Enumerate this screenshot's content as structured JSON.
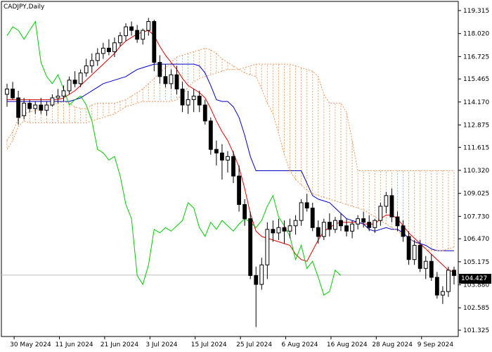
{
  "chart_data": {
    "type": "candlestick",
    "title": "CADJPY,Daily",
    "symbol": "CADJPY",
    "timeframe": "Daily",
    "current_price": "104.427",
    "ylim": [
      101.325,
      119.315
    ],
    "y_ticks": [
      "119.315",
      "118.020",
      "116.725",
      "115.465",
      "114.170",
      "112.875",
      "111.615",
      "110.320",
      "109.025",
      "107.730",
      "106.470",
      "105.175",
      "103.880",
      "102.585",
      "101.325"
    ],
    "x_ticks": [
      {
        "label": "30 May 2024",
        "index": 2
      },
      {
        "label": "11 Jun 2024",
        "index": 10
      },
      {
        "label": "21 Jun 2024",
        "index": 18
      },
      {
        "label": "3 Jul 2024",
        "index": 26
      },
      {
        "label": "15 Jul 2024",
        "index": 34
      },
      {
        "label": "25 Jul 2024",
        "index": 42
      },
      {
        "label": "6 Aug 2024",
        "index": 50
      },
      {
        "label": "16 Aug 2024",
        "index": 58
      },
      {
        "label": "28 Aug 2024",
        "index": 66
      },
      {
        "label": "9 Sep 2024",
        "index": 74
      }
    ],
    "candles": [
      [
        114.6,
        115.2,
        113.9,
        114.9
      ],
      [
        114.9,
        115.3,
        114.3,
        114.4
      ],
      [
        114.4,
        114.8,
        112.9,
        113.3
      ],
      [
        113.4,
        114.4,
        113.2,
        114.1
      ],
      [
        114.1,
        114.3,
        113.6,
        113.8
      ],
      [
        113.8,
        114.2,
        113.5,
        114.0
      ],
      [
        114.0,
        114.4,
        113.5,
        113.7
      ],
      [
        113.7,
        114.2,
        113.4,
        114.0
      ],
      [
        114.0,
        114.6,
        113.9,
        114.4
      ],
      [
        114.4,
        114.9,
        114.1,
        114.5
      ],
      [
        114.5,
        115.1,
        114.2,
        114.8
      ],
      [
        114.8,
        115.6,
        114.6,
        115.4
      ],
      [
        115.4,
        115.9,
        115.0,
        115.2
      ],
      [
        115.2,
        116.0,
        115.0,
        115.8
      ],
      [
        115.8,
        116.6,
        115.6,
        116.2
      ],
      [
        116.2,
        116.9,
        115.8,
        116.5
      ],
      [
        116.5,
        117.2,
        116.2,
        116.9
      ],
      [
        116.9,
        117.5,
        116.6,
        117.2
      ],
      [
        117.2,
        117.7,
        116.8,
        117.0
      ],
      [
        117.0,
        117.8,
        116.7,
        117.5
      ],
      [
        117.5,
        118.1,
        117.3,
        117.9
      ],
      [
        117.9,
        118.6,
        117.6,
        118.4
      ],
      [
        118.4,
        118.7,
        117.9,
        118.2
      ],
      [
        118.2,
        118.5,
        117.5,
        117.7
      ],
      [
        117.7,
        118.3,
        117.4,
        118.2
      ],
      [
        118.2,
        118.9,
        117.9,
        118.7
      ],
      [
        118.7,
        118.8,
        115.9,
        116.4
      ],
      [
        116.4,
        116.8,
        115.2,
        115.6
      ],
      [
        115.6,
        116.3,
        115.0,
        115.2
      ],
      [
        115.2,
        116.0,
        114.9,
        115.7
      ],
      [
        115.7,
        116.2,
        114.6,
        114.9
      ],
      [
        114.9,
        115.3,
        113.6,
        114.0
      ],
      [
        114.0,
        114.8,
        113.5,
        114.3
      ],
      [
        114.3,
        114.9,
        113.6,
        114.5
      ],
      [
        114.5,
        114.8,
        113.6,
        114.0
      ],
      [
        114.0,
        114.3,
        112.9,
        113.1
      ],
      [
        113.1,
        113.3,
        111.2,
        111.5
      ],
      [
        111.5,
        112.0,
        110.6,
        111.3
      ],
      [
        111.3,
        111.8,
        109.8,
        110.9
      ],
      [
        110.9,
        111.4,
        110.2,
        111.1
      ],
      [
        111.1,
        111.4,
        109.6,
        110.0
      ],
      [
        110.0,
        110.6,
        108.0,
        108.4
      ],
      [
        108.4,
        108.7,
        107.2,
        107.6
      ],
      [
        107.6,
        108.0,
        104.2,
        104.4
      ],
      [
        104.4,
        104.9,
        101.5,
        103.9
      ],
      [
        103.9,
        105.4,
        103.6,
        105.0
      ],
      [
        105.0,
        107.4,
        104.2,
        107.0
      ],
      [
        107.0,
        107.5,
        106.3,
        106.8
      ],
      [
        106.8,
        107.6,
        106.4,
        107.1
      ],
      [
        107.1,
        107.5,
        106.2,
        106.9
      ],
      [
        106.9,
        107.6,
        106.5,
        107.2
      ],
      [
        107.2,
        107.8,
        106.7,
        107.5
      ],
      [
        107.5,
        108.7,
        107.2,
        108.5
      ],
      [
        108.5,
        109.0,
        108.0,
        108.2
      ],
      [
        108.2,
        108.5,
        106.9,
        107.1
      ],
      [
        107.1,
        107.5,
        106.2,
        106.6
      ],
      [
        106.6,
        107.6,
        106.4,
        107.4
      ],
      [
        107.4,
        107.9,
        106.6,
        107.0
      ],
      [
        107.0,
        107.7,
        106.8,
        107.5
      ],
      [
        107.5,
        107.9,
        106.9,
        107.2
      ],
      [
        107.2,
        107.6,
        106.6,
        106.9
      ],
      [
        106.9,
        107.5,
        106.5,
        107.3
      ],
      [
        107.3,
        107.8,
        107.0,
        107.6
      ],
      [
        107.6,
        108.0,
        107.1,
        107.4
      ],
      [
        107.4,
        107.8,
        106.9,
        107.1
      ],
      [
        107.1,
        107.6,
        106.8,
        107.5
      ],
      [
        107.5,
        108.5,
        107.2,
        108.3
      ],
      [
        108.3,
        109.1,
        107.9,
        108.9
      ],
      [
        108.9,
        109.3,
        107.4,
        107.7
      ],
      [
        107.7,
        108.0,
        106.9,
        107.2
      ],
      [
        107.2,
        107.5,
        106.3,
        106.6
      ],
      [
        106.6,
        106.9,
        105.0,
        105.3
      ],
      [
        105.3,
        106.4,
        105.0,
        106.1
      ],
      [
        106.1,
        106.4,
        104.6,
        104.8
      ],
      [
        104.8,
        105.5,
        104.2,
        105.2
      ],
      [
        105.2,
        105.6,
        104.1,
        104.3
      ],
      [
        104.3,
        104.6,
        103.1,
        103.3
      ],
      [
        103.3,
        103.8,
        102.8,
        103.5
      ],
      [
        103.5,
        104.9,
        103.2,
        104.7
      ],
      [
        104.7,
        104.9,
        103.9,
        104.4
      ]
    ],
    "indicators": [
      {
        "name": "tenkan",
        "color": "#dd0000",
        "values": [
          114.3,
          114.3,
          114.3,
          114.3,
          114.3,
          114.3,
          114.3,
          114.3,
          114.3,
          114.3,
          114.4,
          114.6,
          114.8,
          115.1,
          115.4,
          115.7,
          116.0,
          116.3,
          116.6,
          116.9,
          117.3,
          117.6,
          117.8,
          118.0,
          118.1,
          118.2,
          117.9,
          117.3,
          116.8,
          116.4,
          116.0,
          115.5,
          115.1,
          114.9,
          114.7,
          114.4,
          113.8,
          113.1,
          112.5,
          112.0,
          111.3,
          110.5,
          109.3,
          107.9,
          106.9,
          106.6,
          106.5,
          106.4,
          106.3,
          106.2,
          106.1,
          105.6,
          105.3,
          105.2,
          105.8,
          106.4,
          106.9,
          107.1,
          107.3,
          107.4,
          107.4,
          107.4,
          107.4,
          107.3,
          107.3,
          107.3,
          107.6,
          107.8,
          107.8,
          107.6,
          107.2,
          106.8,
          106.5,
          106.2,
          105.9,
          105.6,
          105.3,
          105.0,
          104.7,
          104.6
        ]
      },
      {
        "name": "kijun",
        "color": "#0000cc",
        "values": [
          114.2,
          114.2,
          114.2,
          114.2,
          114.2,
          114.2,
          114.2,
          114.2,
          114.2,
          114.2,
          114.2,
          114.2,
          114.3,
          114.4,
          114.6,
          114.8,
          115.0,
          115.2,
          115.3,
          115.4,
          115.5,
          115.6,
          115.8,
          116.0,
          116.1,
          116.2,
          116.3,
          116.3,
          116.3,
          116.3,
          116.3,
          116.3,
          116.3,
          116.3,
          116.2,
          115.8,
          115.1,
          114.3,
          114.2,
          114.2,
          113.9,
          113.3,
          112.3,
          111.1,
          110.3,
          110.3,
          110.3,
          110.3,
          110.3,
          110.3,
          110.3,
          110.3,
          110.3,
          109.6,
          108.9,
          108.7,
          108.6,
          108.5,
          108.2,
          107.9,
          107.6,
          107.5,
          107.4,
          107.3,
          107.0,
          106.9,
          107.0,
          107.1,
          107.0,
          107.0,
          106.8,
          106.5,
          106.3,
          106.2,
          106.1,
          105.9,
          105.8,
          105.8,
          105.8,
          105.8
        ]
      },
      {
        "name": "chikou",
        "color": "#00cc00",
        "values": [
          117.9,
          118.4,
          118.2,
          117.7,
          118.2,
          118.7,
          116.4,
          115.6,
          115.2,
          115.7,
          114.9,
          114.0,
          114.3,
          114.5,
          114.0,
          113.1,
          111.5,
          111.3,
          110.9,
          111.1,
          110.0,
          108.4,
          107.6,
          104.4,
          103.9,
          105.0,
          107.0,
          106.8,
          107.1,
          106.9,
          107.2,
          107.5,
          108.5,
          108.2,
          107.1,
          106.6,
          107.4,
          107.0,
          107.5,
          107.2,
          106.9,
          107.3,
          107.6,
          107.4,
          107.1,
          107.5,
          108.3,
          108.9,
          107.7,
          107.2,
          106.6,
          105.3,
          106.1,
          104.8,
          105.2,
          104.3,
          103.3,
          103.5,
          104.7,
          104.4
        ]
      },
      {
        "name": "senkou_a",
        "color": "#e8985e",
        "dashed": true,
        "values": [
          112.0,
          112.5,
          113.2,
          113.5,
          113.6,
          113.7,
          113.8,
          113.9,
          114.0,
          114.1,
          114.2,
          114.1,
          113.9,
          113.8,
          113.8,
          114.0,
          114.1,
          114.1,
          114.1,
          114.1,
          114.2,
          114.3,
          114.5,
          114.7,
          114.9,
          115.2,
          115.5,
          115.8,
          116.1,
          116.4,
          116.7,
          116.8,
          116.9,
          117.0,
          117.1,
          117.2,
          117.1,
          116.9,
          116.6,
          116.4,
          116.2,
          116.0,
          115.8,
          115.7,
          115.6,
          114.9,
          114.1,
          113.5,
          112.4,
          111.2,
          110.3,
          109.8,
          109.5,
          109.2,
          109.0,
          108.9,
          108.8,
          108.7,
          108.6,
          108.5,
          108.4,
          108.3,
          108.2,
          108.1,
          107.9,
          107.7,
          107.5,
          107.3,
          107.1,
          106.9,
          106.7,
          106.5,
          106.3,
          106.1,
          105.9,
          105.8,
          105.8,
          105.8,
          105.9,
          106.0
        ]
      },
      {
        "name": "senkou_b",
        "color": "#e8985e",
        "dashed": true,
        "values": [
          111.5,
          112.0,
          112.8,
          113.1,
          113.0,
          113.0,
          113.0,
          113.0,
          113.0,
          113.0,
          113.0,
          113.0,
          113.0,
          113.0,
          113.0,
          113.1,
          113.2,
          113.3,
          113.4,
          113.5,
          113.7,
          113.9,
          114.0,
          114.1,
          114.2,
          114.2,
          114.2,
          114.2,
          114.2,
          114.2,
          114.3,
          114.6,
          115.0,
          115.3,
          115.5,
          115.6,
          115.7,
          115.8,
          115.9,
          116.0,
          116.0,
          116.0,
          116.1,
          116.2,
          116.3,
          116.3,
          116.3,
          116.3,
          116.3,
          116.3,
          116.3,
          116.2,
          116.1,
          116.0,
          115.9,
          115.6,
          114.6,
          114.1,
          114.1,
          114.1,
          113.6,
          112.0,
          110.3,
          110.3,
          110.3,
          110.3,
          110.3,
          110.3,
          110.3,
          110.3,
          110.3,
          110.3,
          110.3,
          110.3,
          110.3,
          110.3,
          110.3,
          110.3,
          110.3,
          110.3
        ]
      }
    ]
  }
}
